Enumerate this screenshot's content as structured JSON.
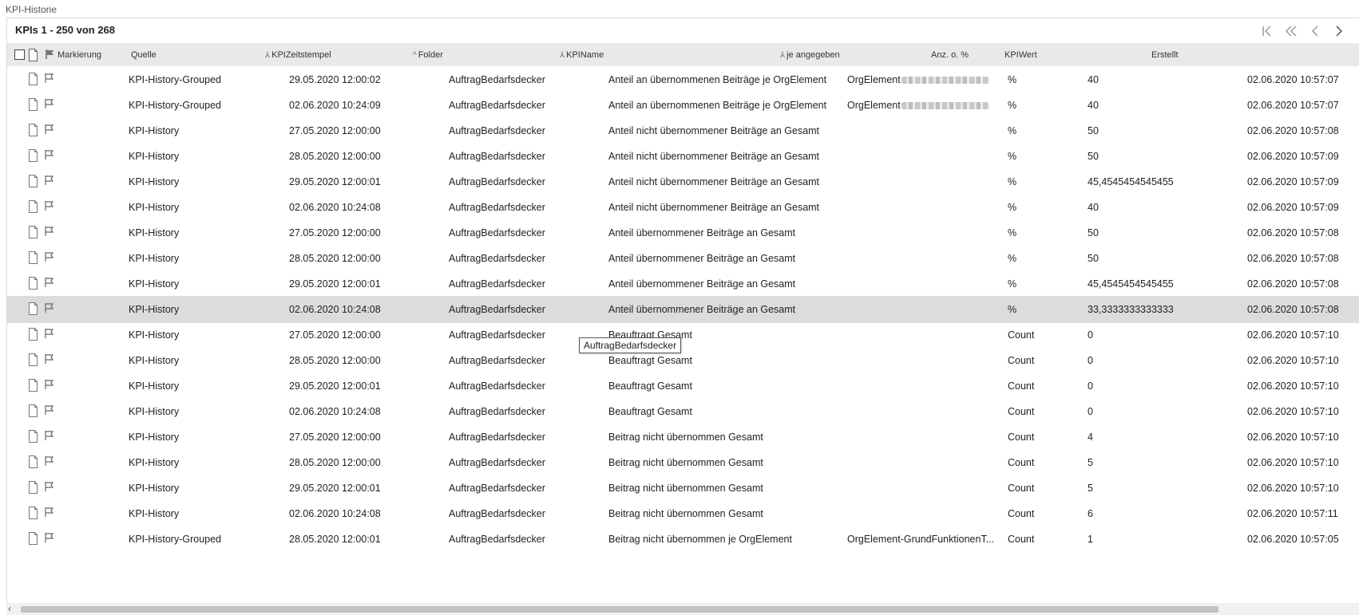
{
  "window_title": "KPI-Historie",
  "count_label": "KPIs 1 - 250 von 268",
  "pager": {
    "first": "⇤",
    "prev_page": "«",
    "prev": "‹",
    "next": "›",
    "last": "⇥"
  },
  "columns": {
    "markierung": "Markierung",
    "quelle": "Quelle",
    "kpizeitstempel": "KPIZeitstempel",
    "folder": "Folder",
    "kpiname": "KPIName",
    "je_angegeben": "je angegeben",
    "anz": "Anz. o. %",
    "kpiwert": "KPIWert",
    "erstellt": "Erstellt"
  },
  "rows": [
    {
      "quelle": "KPI-History-Grouped",
      "zeit": "29.05.2020 12:00:02",
      "folder": "AuftragBedarfsdecker",
      "name": "Anteil an übernommenen Beiträge je OrgElement",
      "je": "OrgElement",
      "anz": "%",
      "wert": "40",
      "erstellt": "02.06.2020 10:57:07"
    },
    {
      "quelle": "KPI-History-Grouped",
      "zeit": "02.06.2020 10:24:09",
      "folder": "AuftragBedarfsdecker",
      "name": "Anteil an übernommenen Beiträge je OrgElement",
      "je": "OrgElement",
      "anz": "%",
      "wert": "40",
      "erstellt": "02.06.2020 10:57:07"
    },
    {
      "quelle": "KPI-History",
      "zeit": "27.05.2020 12:00:00",
      "folder": "AuftragBedarfsdecker",
      "name": "Anteil nicht übernommener Beiträge an Gesamt",
      "je": "",
      "anz": "%",
      "wert": "50",
      "erstellt": "02.06.2020 10:57:08"
    },
    {
      "quelle": "KPI-History",
      "zeit": "28.05.2020 12:00:00",
      "folder": "AuftragBedarfsdecker",
      "name": "Anteil nicht übernommener Beiträge an Gesamt",
      "je": "",
      "anz": "%",
      "wert": "50",
      "erstellt": "02.06.2020 10:57:09"
    },
    {
      "quelle": "KPI-History",
      "zeit": "29.05.2020 12:00:01",
      "folder": "AuftragBedarfsdecker",
      "name": "Anteil nicht übernommener Beiträge an Gesamt",
      "je": "",
      "anz": "%",
      "wert": "45,4545454545455",
      "erstellt": "02.06.2020 10:57:09"
    },
    {
      "quelle": "KPI-History",
      "zeit": "02.06.2020 10:24:08",
      "folder": "AuftragBedarfsdecker",
      "name": "Anteil nicht übernommener Beiträge an Gesamt",
      "je": "",
      "anz": "%",
      "wert": "40",
      "erstellt": "02.06.2020 10:57:09"
    },
    {
      "quelle": "KPI-History",
      "zeit": "27.05.2020 12:00:00",
      "folder": "AuftragBedarfsdecker",
      "name": "Anteil übernommener Beiträge an Gesamt",
      "je": "",
      "anz": "%",
      "wert": "50",
      "erstellt": "02.06.2020 10:57:08"
    },
    {
      "quelle": "KPI-History",
      "zeit": "28.05.2020 12:00:00",
      "folder": "AuftragBedarfsdecker",
      "name": "Anteil übernommener Beiträge an Gesamt",
      "je": "",
      "anz": "%",
      "wert": "50",
      "erstellt": "02.06.2020 10:57:08"
    },
    {
      "quelle": "KPI-History",
      "zeit": "29.05.2020 12:00:01",
      "folder": "AuftragBedarfsdecker",
      "name": "Anteil übernommener Beiträge an Gesamt",
      "je": "",
      "anz": "%",
      "wert": "45,4545454545455",
      "erstellt": "02.06.2020 10:57:08"
    },
    {
      "quelle": "KPI-History",
      "zeit": "02.06.2020 10:24:08",
      "folder": "AuftragBedarfsdecker",
      "name": "Anteil übernommener Beiträge an Gesamt",
      "je": "",
      "anz": "%",
      "wert": "33,3333333333333",
      "erstellt": "02.06.2020 10:57:08"
    },
    {
      "quelle": "KPI-History",
      "zeit": "27.05.2020 12:00:00",
      "folder": "AuftragBedarfsdecker",
      "name": "Beauftragt Gesamt",
      "je": "",
      "anz": "Count",
      "wert": "0",
      "erstellt": "02.06.2020 10:57:10"
    },
    {
      "quelle": "KPI-History",
      "zeit": "28.05.2020 12:00:00",
      "folder": "AuftragBedarfsdecker",
      "name": "Beauftragt Gesamt",
      "je": "",
      "anz": "Count",
      "wert": "0",
      "erstellt": "02.06.2020 10:57:10"
    },
    {
      "quelle": "KPI-History",
      "zeit": "29.05.2020 12:00:01",
      "folder": "AuftragBedarfsdecker",
      "name": "Beauftragt Gesamt",
      "je": "",
      "anz": "Count",
      "wert": "0",
      "erstellt": "02.06.2020 10:57:10"
    },
    {
      "quelle": "KPI-History",
      "zeit": "02.06.2020 10:24:08",
      "folder": "AuftragBedarfsdecker",
      "name": "Beauftragt Gesamt",
      "je": "",
      "anz": "Count",
      "wert": "0",
      "erstellt": "02.06.2020 10:57:10"
    },
    {
      "quelle": "KPI-History",
      "zeit": "27.05.2020 12:00:00",
      "folder": "AuftragBedarfsdecker",
      "name": "Beitrag nicht übernommen Gesamt",
      "je": "",
      "anz": "Count",
      "wert": "4",
      "erstellt": "02.06.2020 10:57:10"
    },
    {
      "quelle": "KPI-History",
      "zeit": "28.05.2020 12:00:00",
      "folder": "AuftragBedarfsdecker",
      "name": "Beitrag nicht übernommen Gesamt",
      "je": "",
      "anz": "Count",
      "wert": "5",
      "erstellt": "02.06.2020 10:57:10"
    },
    {
      "quelle": "KPI-History",
      "zeit": "29.05.2020 12:00:01",
      "folder": "AuftragBedarfsdecker",
      "name": "Beitrag nicht übernommen Gesamt",
      "je": "",
      "anz": "Count",
      "wert": "5",
      "erstellt": "02.06.2020 10:57:10"
    },
    {
      "quelle": "KPI-History",
      "zeit": "02.06.2020 10:24:08",
      "folder": "AuftragBedarfsdecker",
      "name": "Beitrag nicht übernommen Gesamt",
      "je": "",
      "anz": "Count",
      "wert": "6",
      "erstellt": "02.06.2020 10:57:11"
    },
    {
      "quelle": "KPI-History-Grouped",
      "zeit": "28.05.2020 12:00:01",
      "folder": "AuftragBedarfsdecker",
      "name": "Beitrag nicht übernommen je OrgElement",
      "je": "OrgElement-GrundFunktionenT...",
      "anz": "Count",
      "wert": "1",
      "erstellt": "02.06.2020 10:57:05"
    }
  ],
  "selected_row_index": 9,
  "blurred_rows": [
    0,
    1
  ],
  "tooltip": "AuftragBedarfsdecker",
  "colors": {
    "header_bg": "#e9e9e9",
    "selected_row_bg": "#dcdcdc"
  }
}
